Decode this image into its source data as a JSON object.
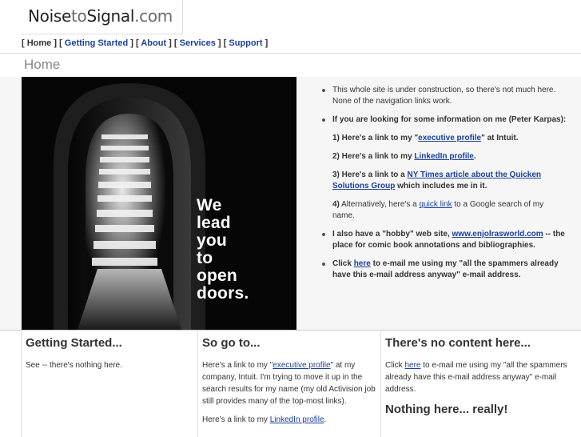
{
  "logo": {
    "part1": "Noise",
    "part2": "to",
    "part3": "Signal",
    "part4": ".com"
  },
  "nav": {
    "items": [
      {
        "label": "Home",
        "link": false
      },
      {
        "label": "Getting Started",
        "link": true
      },
      {
        "label": "About",
        "link": true
      },
      {
        "label": "Services",
        "link": true
      },
      {
        "label": "Support",
        "link": true
      }
    ]
  },
  "page_title": "Home",
  "hero": {
    "l1": "We",
    "l2": "lead",
    "l3": "you",
    "l4": "to",
    "l5": "open",
    "l6": "doors."
  },
  "main": {
    "b1": "This whole site is under construction, so there's not much here.  None of the navigation links work.",
    "b2_text": "If you are looking for some information on me (Peter Karpas):",
    "p1_pre": "1) Here's a link to my \"",
    "p1_link": "executive profile",
    "p1_post": "\" at Intuit.",
    "p2_pre": "2) Here's a link to my ",
    "p2_link": "LinkedIn profile",
    "p2_post": ".",
    "p3_pre": "3) Here's a link to a ",
    "p3_link": "NY Times article about the Quicken Solutions Group",
    "p3_post": " which includes me in it.",
    "p4_pre": " Alternatively, here's a ",
    "p4_num": "4)",
    "p4_link": "quick link",
    "p4_post": " to a Google search of my name.",
    "b3_pre": "I also have a \"hobby\" web site, ",
    "b3_link": "www.enjolrasworld.com",
    "b3_post": " -- the place for comic book annotations and bibliographies.",
    "b4_pre": "Click ",
    "b4_link": "here",
    "b4_post": " to e-mail me using my \"all the spammers already have this e-mail address anyway\" e-mail address."
  },
  "col1": {
    "title": "Getting Started...",
    "text": "See -- there's nothing here."
  },
  "col2": {
    "title": "So go to...",
    "p1_pre": "Here's a link to my \"",
    "p1_link": "executive profile",
    "p1_post": "\" at my company, Intuit.  I'm trying to move it up in the search results for my name (my old Activision job still provides many of the top-most links).",
    "p2_pre": "Here's a link to my ",
    "p2_link": "LinkedIn profile",
    "p2_post": "."
  },
  "col3": {
    "title": "There's no content here...",
    "p_pre": "Click ",
    "p_link": "here",
    "p_post": " to e-mail me using my \"all the spammers already have this e-mail address anyway\" e-mail address.",
    "title2": "Nothing here... really!"
  }
}
